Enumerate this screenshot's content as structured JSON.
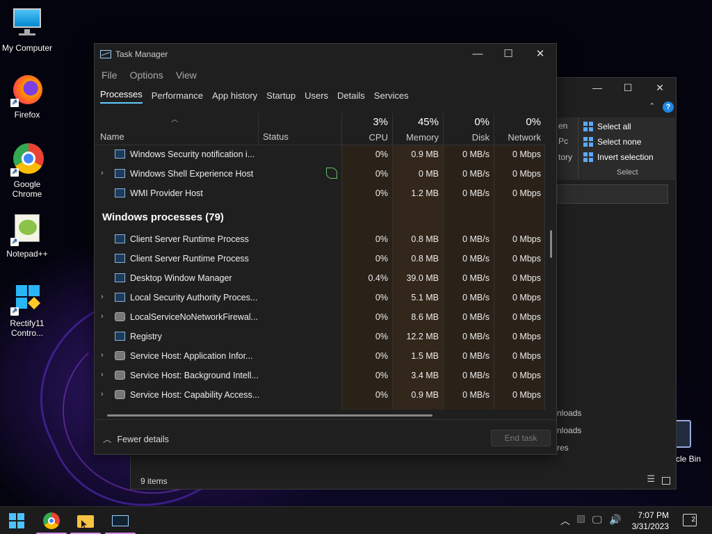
{
  "desktop": {
    "icons": [
      {
        "label": "My Computer"
      },
      {
        "label": "Firefox"
      },
      {
        "label": "Google Chrome"
      },
      {
        "label": "Notepad++"
      },
      {
        "label": "Rectify11 Contro..."
      }
    ],
    "recycle_bin_partial": "cle Bin"
  },
  "explorer": {
    "ribbon": {
      "select_all": "Select all",
      "select_none": "Select none",
      "invert_selection": "Invert selection",
      "group_label": "Select",
      "open_partial": "en",
      "history_partial": "tory",
      "p_partial": "Pc"
    },
    "nav_partials": [
      "nloads",
      "nloads",
      "res"
    ],
    "status": "9 items"
  },
  "taskmanager": {
    "title": "Task Manager",
    "menu": [
      "File",
      "Options",
      "View"
    ],
    "tabs": [
      "Processes",
      "Performance",
      "App history",
      "Startup",
      "Users",
      "Details",
      "Services"
    ],
    "columns": {
      "name": "Name",
      "status": "Status",
      "cpu": {
        "pct": "3%",
        "label": "CPU"
      },
      "memory": {
        "pct": "45%",
        "label": "Memory"
      },
      "disk": {
        "pct": "0%",
        "label": "Disk"
      },
      "network": {
        "pct": "0%",
        "label": "Network"
      }
    },
    "rows_top": [
      {
        "name": "Windows Security notification i...",
        "cpu": "0%",
        "mem": "0.9 MB",
        "disk": "0 MB/s",
        "net": "0 Mbps"
      },
      {
        "name": "Windows Shell Experience Host",
        "cpu": "0%",
        "mem": "0 MB",
        "disk": "0 MB/s",
        "net": "0 Mbps"
      },
      {
        "name": "WMI Provider Host",
        "cpu": "0%",
        "mem": "1.2 MB",
        "disk": "0 MB/s",
        "net": "0 Mbps"
      }
    ],
    "group_title": "Windows processes (79)",
    "rows_windows": [
      {
        "name": "Client Server Runtime Process",
        "cpu": "0%",
        "mem": "0.8 MB",
        "disk": "0 MB/s",
        "net": "0 Mbps"
      },
      {
        "name": "Client Server Runtime Process",
        "cpu": "0%",
        "mem": "0.8 MB",
        "disk": "0 MB/s",
        "net": "0 Mbps"
      },
      {
        "name": "Desktop Window Manager",
        "cpu": "0.4%",
        "mem": "39.0 MB",
        "disk": "0 MB/s",
        "net": "0 Mbps"
      },
      {
        "name": "Local Security Authority Proces...",
        "cpu": "0%",
        "mem": "5.1 MB",
        "disk": "0 MB/s",
        "net": "0 Mbps"
      },
      {
        "name": "LocalServiceNoNetworkFirewal...",
        "cpu": "0%",
        "mem": "8.6 MB",
        "disk": "0 MB/s",
        "net": "0 Mbps"
      },
      {
        "name": "Registry",
        "cpu": "0%",
        "mem": "12.2 MB",
        "disk": "0 MB/s",
        "net": "0 Mbps"
      },
      {
        "name": "Service Host: Application Infor...",
        "cpu": "0%",
        "mem": "1.5 MB",
        "disk": "0 MB/s",
        "net": "0 Mbps"
      },
      {
        "name": "Service Host: Background Intell...",
        "cpu": "0%",
        "mem": "3.4 MB",
        "disk": "0 MB/s",
        "net": "0 Mbps"
      },
      {
        "name": "Service Host: Capability Access...",
        "cpu": "0%",
        "mem": "0.9 MB",
        "disk": "0 MB/s",
        "net": "0 Mbps"
      }
    ],
    "footer": {
      "fewer_details": "Fewer details",
      "end_task": "End task"
    }
  },
  "taskbar": {
    "clock_time": "7:07 PM",
    "clock_date": "3/31/2023",
    "notification_count": "2",
    "colors": {
      "underline": "#d58de8"
    }
  }
}
